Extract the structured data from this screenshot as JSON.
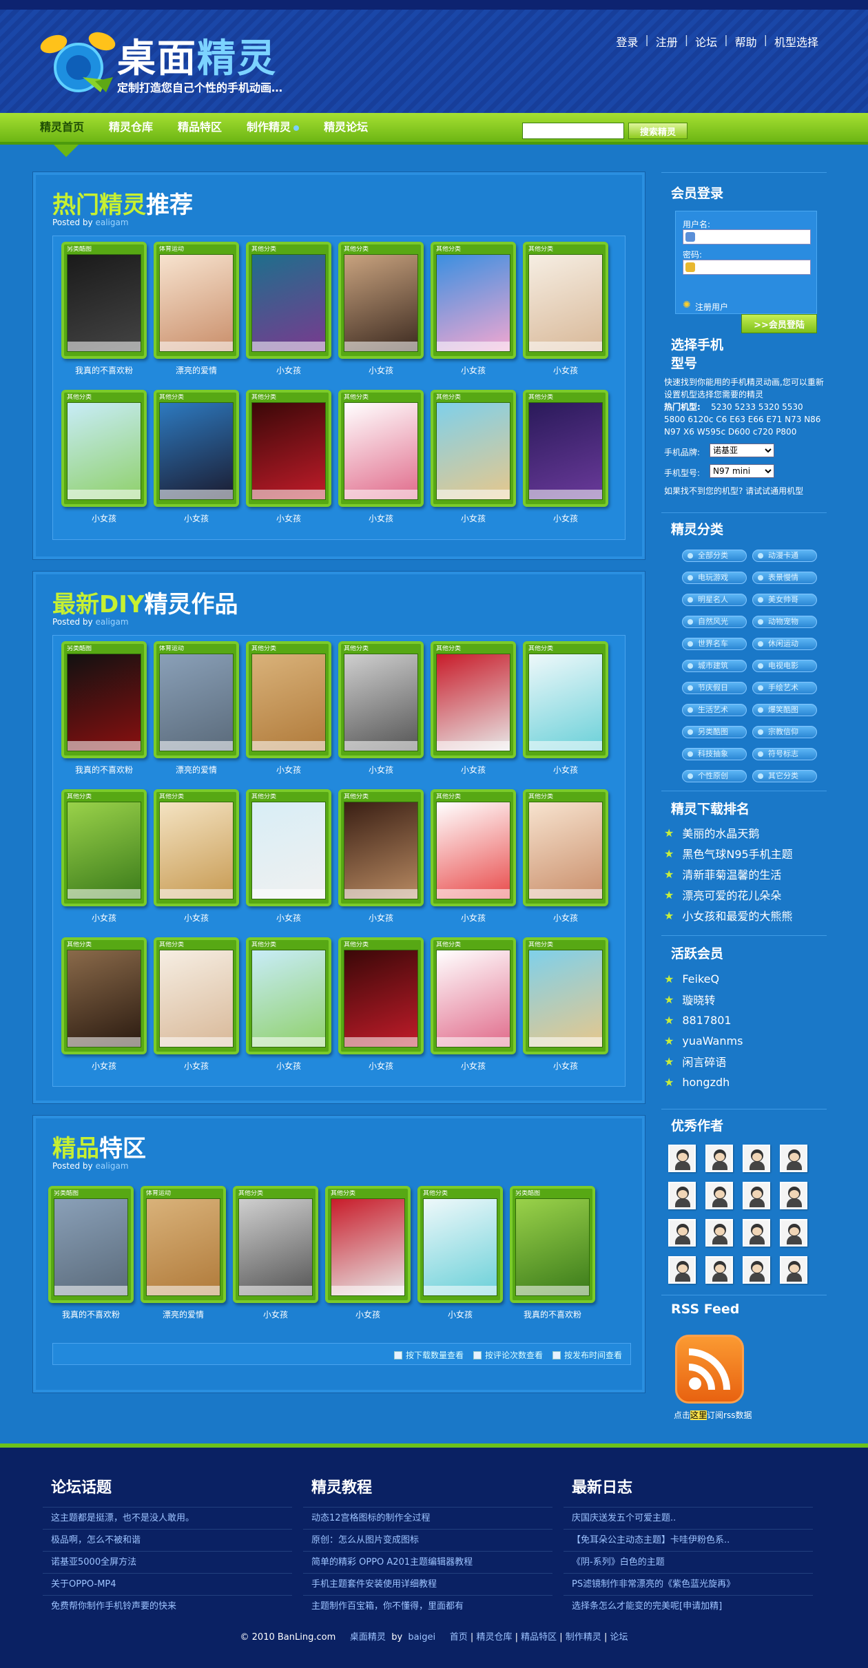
{
  "header": {
    "logo_a": "桌面",
    "logo_b": "精灵",
    "slogan": "定制打造您自己个性的手机动画…",
    "top_links": [
      "登录",
      "注册",
      "论坛",
      "帮助",
      "机型选择"
    ]
  },
  "nav": {
    "items": [
      "精灵首页",
      "精灵仓库",
      "精品特区",
      "制作精灵",
      "精灵论坛"
    ],
    "search_placeholder": "",
    "search_button": "搜索精灵"
  },
  "sections": [
    {
      "title_a": "热门精灵",
      "title_b": "推荐",
      "posted_by": "Posted by",
      "author": "ealigam",
      "items": [
        {
          "tag": "另类酷图",
          "caption": "我真的不喜欢粉",
          "c1": "#1a1a1a",
          "c2": "#444"
        },
        {
          "tag": "体育运动",
          "caption": "漂亮的爱情",
          "c1": "#f7e3cf",
          "c2": "#c98e6a"
        },
        {
          "tag": "其他分类",
          "caption": "小女孩",
          "c1": "#1e6f8c",
          "c2": "#7a3a8f"
        },
        {
          "tag": "其他分类",
          "caption": "小女孩",
          "c1": "#c9a37f",
          "c2": "#3c2a20"
        },
        {
          "tag": "其他分类",
          "caption": "小女孩",
          "c1": "#3b8fe0",
          "c2": "#f3a7d0"
        },
        {
          "tag": "其他分类",
          "caption": "小女孩",
          "c1": "#f6eee3",
          "c2": "#d8b898"
        },
        {
          "tag": "其他分类",
          "caption": "小女孩",
          "c1": "#c8ecf8",
          "c2": "#8fd06a"
        },
        {
          "tag": "其他分类",
          "caption": "小女孩",
          "c1": "#2d7ac0",
          "c2": "#1b1b2f"
        },
        {
          "tag": "其他分类",
          "caption": "小女孩",
          "c1": "#3a0808",
          "c2": "#c21c2a"
        },
        {
          "tag": "其他分类",
          "caption": "小女孩",
          "c1": "#ffffff",
          "c2": "#e06a8a"
        },
        {
          "tag": "其他分类",
          "caption": "小女孩",
          "c1": "#7fd0ea",
          "c2": "#e7c78b"
        },
        {
          "tag": "其他分类",
          "caption": "小女孩",
          "c1": "#2a1a5a",
          "c2": "#6a3a9a"
        }
      ]
    },
    {
      "title_a": "最新DIY",
      "title_b": "精灵作品",
      "posted_by": "Posted by",
      "author": "ealigam",
      "items": [
        {
          "tag": "另类酷图",
          "caption": "我真的不喜欢粉",
          "c1": "#111",
          "c2": "#8a1010"
        },
        {
          "tag": "体育运动",
          "caption": "漂亮的爱情",
          "c1": "#8aa0b8",
          "c2": "#5a6a7a"
        },
        {
          "tag": "其他分类",
          "caption": "小女孩",
          "c1": "#d9b27a",
          "c2": "#b07a3a"
        },
        {
          "tag": "其他分类",
          "caption": "小女孩",
          "c1": "#cfcfcf",
          "c2": "#555"
        },
        {
          "tag": "其他分类",
          "caption": "小女孩",
          "c1": "#c81c2a",
          "c2": "#e8e8e8"
        },
        {
          "tag": "其他分类",
          "caption": "小女孩",
          "c1": "#eef8fa",
          "c2": "#6ad0d8"
        },
        {
          "tag": "其他分类",
          "caption": "小女孩",
          "c1": "#9ad24a",
          "c2": "#3a7a1a"
        },
        {
          "tag": "其他分类",
          "caption": "小女孩",
          "c1": "#f4e3c2",
          "c2": "#c79a52"
        },
        {
          "tag": "其他分类",
          "caption": "小女孩",
          "c1": "#d8eef6",
          "c2": "#f0f0f0"
        },
        {
          "tag": "其他分类",
          "caption": "小女孩",
          "c1": "#3a1f14",
          "c2": "#b88a62"
        },
        {
          "tag": "其他分类",
          "caption": "小女孩",
          "c1": "#ffffff",
          "c2": "#e84a4a"
        },
        {
          "tag": "其他分类",
          "caption": "小女孩",
          "c1": "#f7e3cf",
          "c2": "#c98e6a"
        },
        {
          "tag": "其他分类",
          "caption": "小女孩",
          "c1": "#8a6a4a",
          "c2": "#2a1a10"
        },
        {
          "tag": "其他分类",
          "caption": "小女孩",
          "c1": "#f6eee3",
          "c2": "#d8b898"
        },
        {
          "tag": "其他分类",
          "caption": "小女孩",
          "c1": "#c8ecf8",
          "c2": "#8fd06a"
        },
        {
          "tag": "其他分类",
          "caption": "小女孩",
          "c1": "#3a0808",
          "c2": "#c21c2a"
        },
        {
          "tag": "其他分类",
          "caption": "小女孩",
          "c1": "#ffffff",
          "c2": "#e06a8a"
        },
        {
          "tag": "其他分类",
          "caption": "小女孩",
          "c1": "#7fd0ea",
          "c2": "#e7c78b"
        }
      ]
    },
    {
      "title_a": "精品",
      "title_b": "特区",
      "posted_by": "Posted by",
      "author": "ealigam",
      "items": [
        {
          "tag": "另类酷图",
          "caption": "我真的不喜欢粉",
          "c1": "#8aa0b8",
          "c2": "#5a6a7a"
        },
        {
          "tag": "体育运动",
          "caption": "漂亮的爱情",
          "c1": "#d9b27a",
          "c2": "#b07a3a"
        },
        {
          "tag": "其他分类",
          "caption": "小女孩",
          "c1": "#cfcfcf",
          "c2": "#555"
        },
        {
          "tag": "其他分类",
          "caption": "小女孩",
          "c1": "#c81c2a",
          "c2": "#e8e8e8"
        },
        {
          "tag": "其他分类",
          "caption": "小女孩",
          "c1": "#eef8fa",
          "c2": "#6ad0d8"
        },
        {
          "tag": "另类酷图",
          "caption": "我真的不喜欢粉",
          "c1": "#9ad24a",
          "c2": "#3a7a1a"
        }
      ],
      "sort_options": [
        "按下载数量查看",
        "按评论次数查看",
        "按发布时间查看"
      ]
    }
  ],
  "sidebar": {
    "login": {
      "title": "会员登录",
      "username_label": "用户名:",
      "password_label": "密码:",
      "register": "注册用户",
      "submit": ">>会员登陆"
    },
    "model": {
      "title_l1": "选择手机",
      "title_l2": "型号",
      "desc": "快速找到你能用的手机精灵动画,您可以重新设置机型选择您需要的精灵",
      "hot_label": "热门机型:",
      "hot_models": "5230 5233 5320 5530 5800 6120c C6 E63 E66 E71 N73 N86 N97 X6 W595c D600 c720 P800",
      "brand_label": "手机品牌:",
      "brand_value": "诺基亚",
      "model_label": "手机型号:",
      "model_value": "N97 mini",
      "not_found": "如果找不到您的机型? 请试试通用机型"
    },
    "categories": {
      "title": "精灵分类",
      "items": [
        "全部分类",
        "动漫卡通",
        "电玩游戏",
        "表景慢情",
        "明星名人",
        "美女帅哥",
        "自然风光",
        "动物宠物",
        "世界名车",
        "休闲运动",
        "城市建筑",
        "电视电影",
        "节庆假日",
        "手绘艺术",
        "生活艺术",
        "爆笑酷图",
        "另类酷图",
        "宗教信仰",
        "科技抽象",
        "符号标志",
        "个性原创",
        "其它分类"
      ]
    },
    "ranking": {
      "title": "精灵下载排名",
      "items": [
        "美丽的水晶天鹅",
        "黑色气球N95手机主题",
        "清新菲菊温馨的生活",
        "漂亮可爱的花儿朵朵",
        "小女孩和最爱的大熊熊"
      ]
    },
    "members": {
      "title": "活跃会员",
      "items": [
        "FeikeQ",
        "璇晓转",
        "8817801",
        "yuaWanms",
        "闲言碎语",
        "hongzdh"
      ]
    },
    "authors": {
      "title": "优秀作者",
      "count": 16
    },
    "rss": {
      "title": "RSS Feed",
      "text_a": "点击",
      "text_hl": "这里",
      "text_b": "订阅rss数据"
    }
  },
  "footer": {
    "columns": [
      {
        "title": "论坛话题",
        "links": [
          "这主题都是挺漂，也不是没人敢用。",
          "极品啊，怎么不被和谐",
          "诺基亚5000全屏方法",
          "关于OPPO-MP4",
          "免费帮你制作手机铃声要的快来"
        ]
      },
      {
        "title": "精灵教程",
        "links": [
          "动态12宫格图标的制作全过程",
          "原创：怎么从图片变成图标",
          "简单的精彩 OPPO A201主题编辑器教程",
          "手机主题套件安装使用详细教程",
          "主题制作百宝箱，你不懂得，里面都有"
        ]
      },
      {
        "title": "最新日志",
        "links": [
          "庆国庆送发五个可爱主题..",
          "【免耳朵公主动态主题】卡哇伊粉色系..",
          "《阴-系列》白色的主题",
          "PS滤镜制作非常漂亮的《紫色蓝光旋再》",
          "选择条怎么才能变的完美呢[申请加精]"
        ]
      }
    ],
    "copyright": "© 2010 BanLing.com",
    "site_name": "桌面精灵",
    "by": "by",
    "by_name": "baigei",
    "links": [
      "首页",
      "精灵仓库",
      "精品特区",
      "制作精灵",
      "论坛"
    ]
  },
  "colors": {
    "background": "#1a78c8",
    "accent_green": "#7bcb2a",
    "title_green": "#c7f031",
    "footer_bg": "#0a2163"
  }
}
